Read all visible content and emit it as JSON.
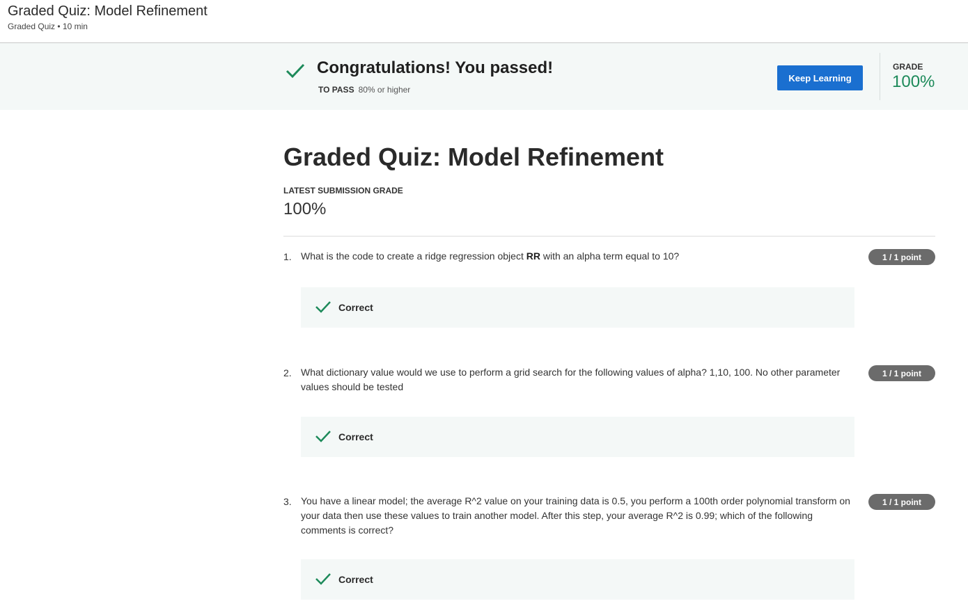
{
  "header": {
    "title": "Graded Quiz: Model Refinement",
    "subtitle": "Graded Quiz • 10 min"
  },
  "banner": {
    "message": "Congratulations! You passed!",
    "to_pass_label": "TO PASS",
    "to_pass_value": "80% or higher",
    "keep_learning_label": "Keep Learning",
    "grade_label": "GRADE",
    "grade_value": "100%",
    "check_icon": "check-icon",
    "accent_color": "#1d8a5a",
    "button_color": "#1a6fd0"
  },
  "main": {
    "title": "Graded Quiz: Model Refinement",
    "latest_label": "LATEST SUBMISSION GRADE",
    "latest_value": "100%"
  },
  "questions": [
    {
      "number": "1.",
      "text_before": "What is the code to create a ridge regression  object ",
      "text_bold": "RR",
      "text_after": " with an alpha term equal to 10?",
      "points": "1 / 1 point",
      "feedback": "Correct"
    },
    {
      "number": "2.",
      "text": "What dictionary value would we use to perform a grid search for the following values of alpha? 1,10, 100. No other parameter values should be tested",
      "points": "1 / 1 point",
      "feedback": "Correct"
    },
    {
      "number": "3.",
      "text": "You have a linear model; the average R^2 value on your training data is 0.5, you perform a 100th order polynomial transform on your data then use these values to train another model. After this step, your average R^2 is 0.99; which of the following comments is correct?",
      "points": "1 / 1 point",
      "feedback": "Correct"
    }
  ]
}
